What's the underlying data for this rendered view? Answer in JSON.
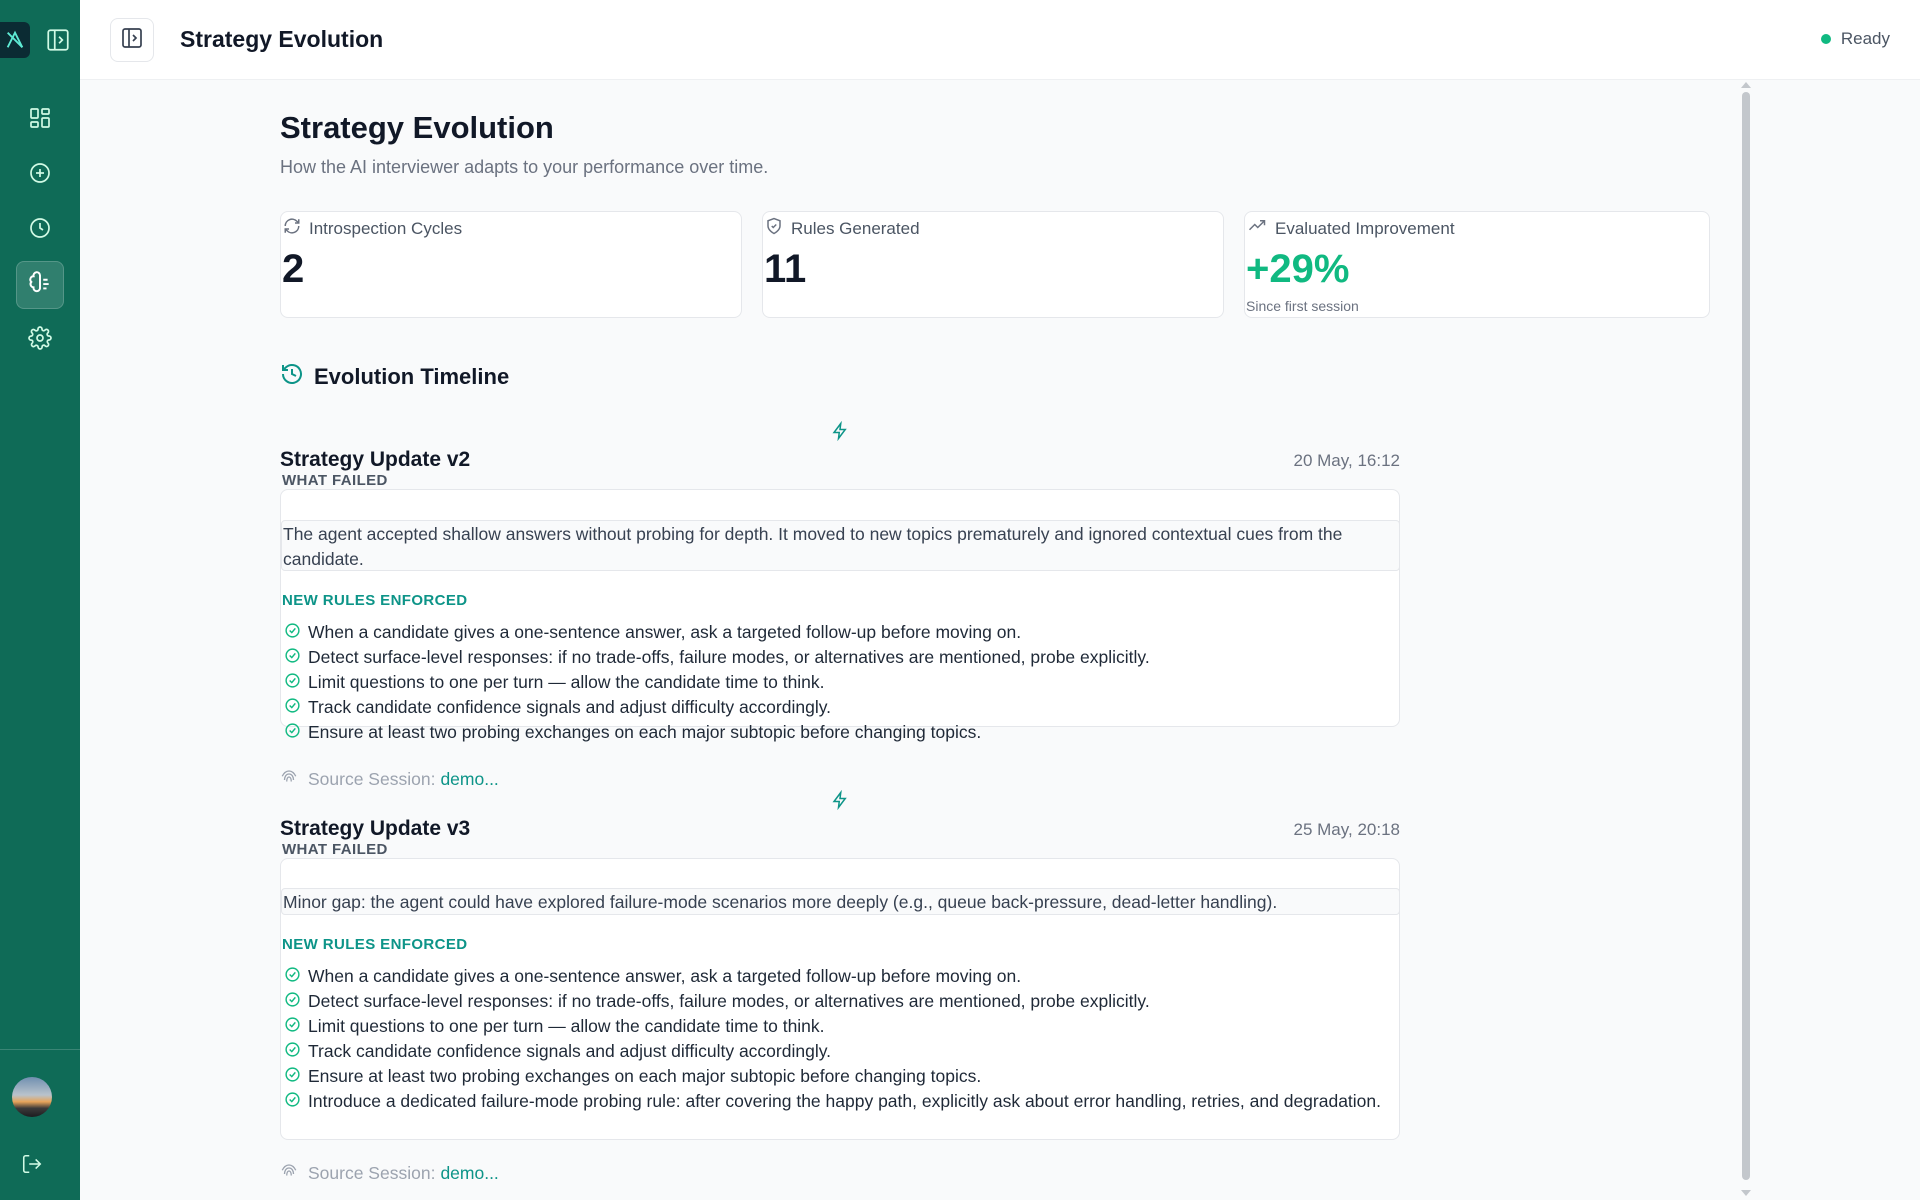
{
  "header": {
    "title": "Strategy Evolution",
    "status": "Ready"
  },
  "sidebar": {
    "items": [
      {
        "icon": "dashboard-icon"
      },
      {
        "icon": "plus-circle-icon"
      },
      {
        "icon": "clock-icon"
      },
      {
        "icon": "brain-icon",
        "active": true
      },
      {
        "icon": "gear-icon"
      }
    ]
  },
  "page": {
    "title": "Strategy Evolution",
    "subtitle": "How the AI interviewer adapts to your performance over time."
  },
  "stats": [
    {
      "label": "Introspection Cycles",
      "value": "2",
      "icon": "refresh-icon"
    },
    {
      "label": "Rules Generated",
      "value": "11",
      "icon": "shield-check-icon"
    },
    {
      "label": "Evaluated Improvement",
      "value": "+29%",
      "note": "Since first session",
      "icon": "trending-up-icon"
    }
  ],
  "timeline": {
    "title": "Evolution Timeline",
    "what_failed_label": "WHAT FAILED",
    "new_rules_label": "NEW RULES ENFORCED",
    "source_label": "Source Session:",
    "updates": [
      {
        "title": "Strategy Update v2",
        "date": "20 May, 16:12",
        "failed": "The agent accepted shallow answers without probing for depth. It moved to new topics prematurely and ignored contextual cues from the candidate.",
        "rules": [
          "When a candidate gives a one-sentence answer, ask a targeted follow-up before moving on.",
          "Detect surface-level responses: if no trade-offs, failure modes, or alternatives are mentioned, probe explicitly.",
          "Limit questions to one per turn — allow the candidate time to think.",
          "Track candidate confidence signals and adjust difficulty accordingly.",
          "Ensure at least two probing exchanges on each major subtopic before changing topics."
        ],
        "source": "demo..."
      },
      {
        "title": "Strategy Update v3",
        "date": "25 May, 20:18",
        "failed": "Minor gap: the agent could have explored failure-mode scenarios more deeply (e.g., queue back-pressure, dead-letter handling).",
        "rules": [
          "When a candidate gives a one-sentence answer, ask a targeted follow-up before moving on.",
          "Detect surface-level responses: if no trade-offs, failure modes, or alternatives are mentioned, probe explicitly.",
          "Limit questions to one per turn — allow the candidate time to think.",
          "Track candidate confidence signals and adjust difficulty accordingly.",
          "Ensure at least two probing exchanges on each major subtopic before changing topics.",
          "Introduce a dedicated failure-mode probing rule: after covering the happy path, explicitly ask about error handling, retries, and degradation."
        ],
        "source": "demo..."
      }
    ]
  },
  "colors": {
    "sidebar": "#0f6b57",
    "accent": "#0d9488",
    "positive": "#10b981"
  }
}
